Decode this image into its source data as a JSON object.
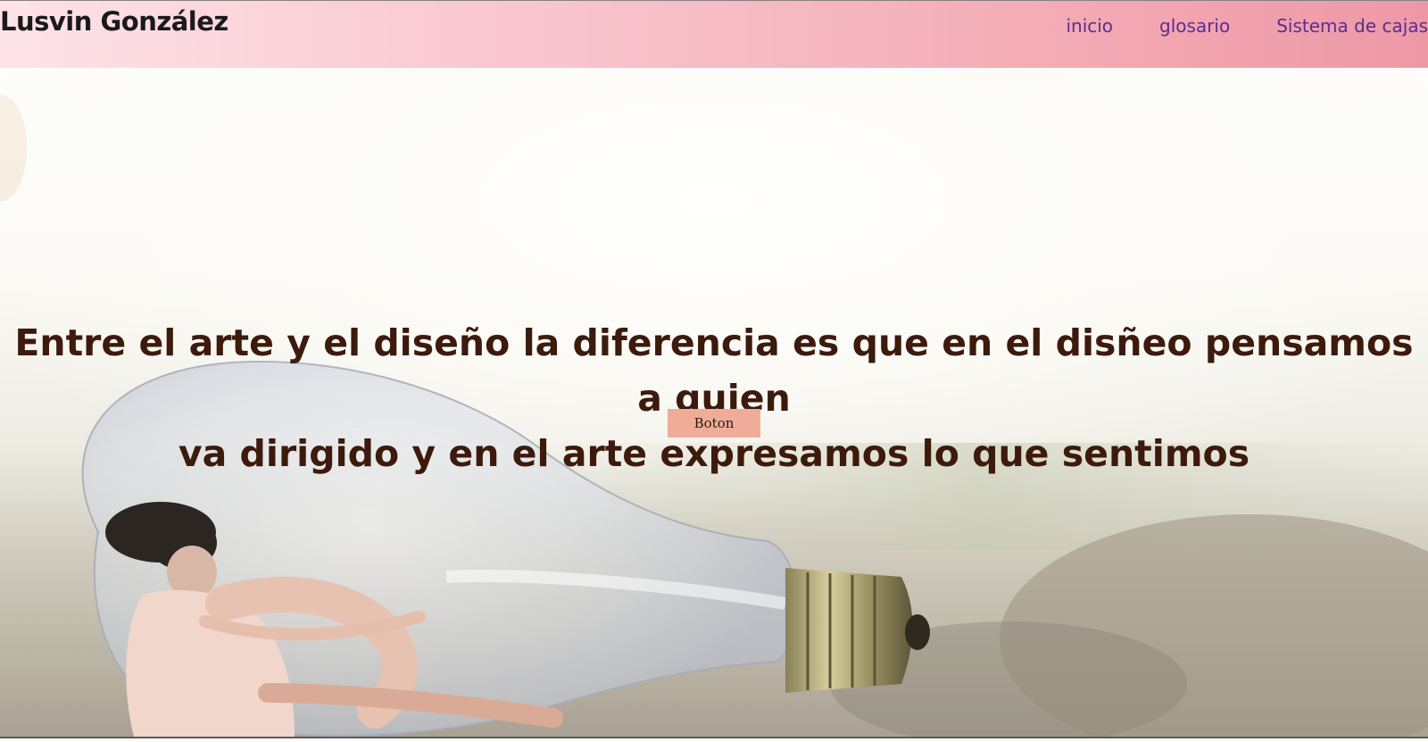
{
  "header": {
    "brand": "Lusvin González",
    "nav": [
      {
        "label": "inicio"
      },
      {
        "label": "glosario"
      },
      {
        "label": "Sistema de cajas"
      }
    ]
  },
  "hero": {
    "headline_line1": "Entre el arte y el diseño la diferencia es que en el disñeo pensamos a quien",
    "headline_line2": "va dirigido y en el arte expresamos lo que sentimos",
    "button_label": "Boton"
  },
  "colors": {
    "header_start": "#fde3e8",
    "header_end": "#ee98a6",
    "nav_link": "#5b2d8e",
    "headline": "#3c1a0c",
    "button_bg": "#efad99"
  }
}
